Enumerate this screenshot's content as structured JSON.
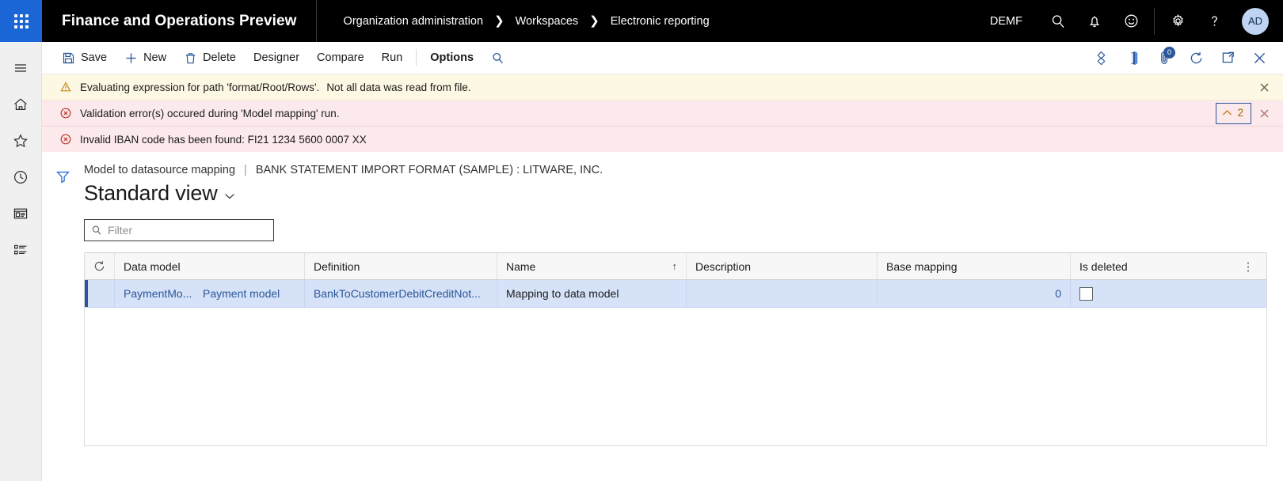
{
  "header": {
    "app_title": "Finance and Operations Preview",
    "waffle_icon": "app-launcher-grid-icon",
    "breadcrumb": [
      "Organization administration",
      "Workspaces",
      "Electronic reporting"
    ],
    "company": "DEMF",
    "icons": [
      "search-icon",
      "notifications-bell-icon",
      "feedback-smiley-icon",
      "settings-gear-icon",
      "help-question-icon"
    ],
    "avatar_initials": "AD"
  },
  "leftnav": {
    "items": [
      "hamburger-menu-icon",
      "home-icon",
      "favorites-star-icon",
      "recent-clock-icon",
      "workspaces-icon",
      "modules-list-icon"
    ]
  },
  "toolbar": {
    "save_label": "Save",
    "new_label": "New",
    "delete_label": "Delete",
    "designer_label": "Designer",
    "compare_label": "Compare",
    "run_label": "Run",
    "options_label": "Options",
    "search_icon": "search-icon",
    "right_icons": [
      "share-icon",
      "open-in-office-icon",
      "attachments-icon",
      "refresh-icon",
      "popout-icon",
      "close-icon"
    ],
    "attachment_count": "0"
  },
  "messages": {
    "warning": {
      "icon": "warning-triangle-icon",
      "text_1": "Evaluating expression for path 'format/Root/Rows'.",
      "text_2": "Not all data was read from file.",
      "close_icon": "close-icon"
    },
    "errors": [
      {
        "icon": "error-circle-icon",
        "text": "Validation error(s) occured during 'Model mapping' run."
      },
      {
        "icon": "error-circle-icon",
        "text": "Invalid IBAN code has been found: FI21 1234 5600 0007 XX"
      }
    ],
    "collapse_count": "2",
    "collapse_icon": "chevron-up-icon",
    "close_icon": "close-icon"
  },
  "page": {
    "filter_pane_icon": "filter-funnel-icon",
    "caption_main": "Model to datasource mapping",
    "caption_sep": "|",
    "caption_sub": "BANK STATEMENT IMPORT FORMAT (SAMPLE) : LITWARE, INC.",
    "view_name": "Standard view",
    "view_chevron": "chevron-down-icon",
    "filter_placeholder": "Filter",
    "filter_value": "",
    "filter_icon": "search-icon"
  },
  "grid": {
    "refresh_icon": "refresh-icon",
    "options_icon": "column-options-ellipsis-icon",
    "columns": [
      {
        "label": "Data model",
        "sort": ""
      },
      {
        "label": "Definition",
        "sort": ""
      },
      {
        "label": "Name",
        "sort": "↑"
      },
      {
        "label": "Description",
        "sort": ""
      },
      {
        "label": "Base mapping",
        "sort": ""
      },
      {
        "label": "Is deleted",
        "sort": ""
      }
    ],
    "rows": [
      {
        "data_model_code": "PaymentMo...",
        "data_model_name": "Payment model",
        "definition": "BankToCustomerDebitCreditNot...",
        "name": "Mapping to data model",
        "description": "",
        "base_mapping": "0",
        "is_deleted": false
      }
    ]
  }
}
